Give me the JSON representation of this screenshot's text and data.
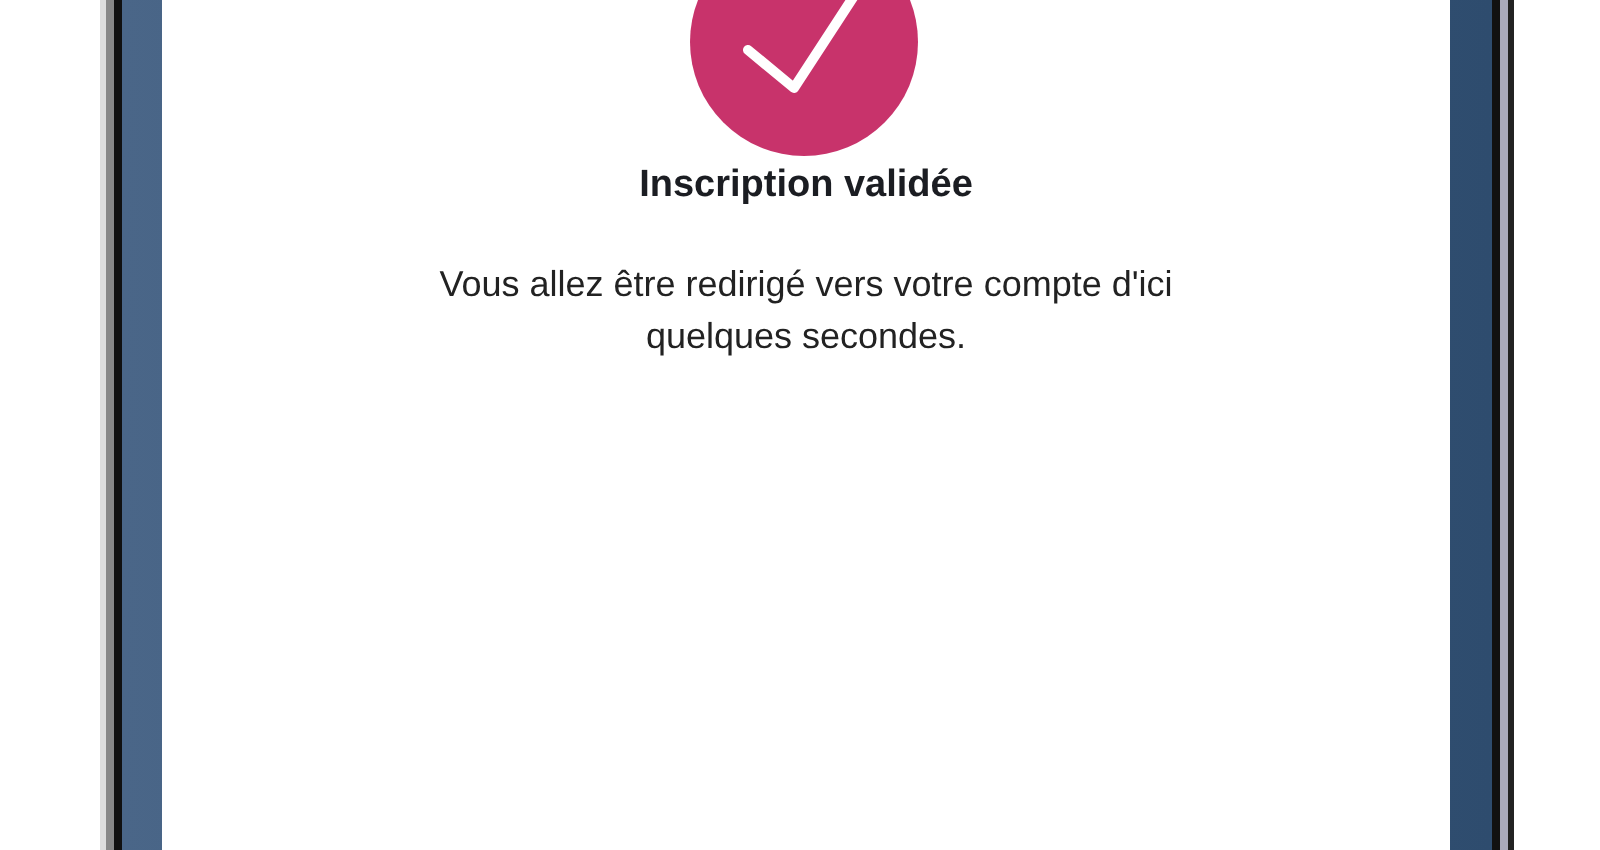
{
  "screen": {
    "title": "Inscription validée",
    "message": "Vous allez être redirigé vers votre compte d'ici quelques secondes."
  }
}
